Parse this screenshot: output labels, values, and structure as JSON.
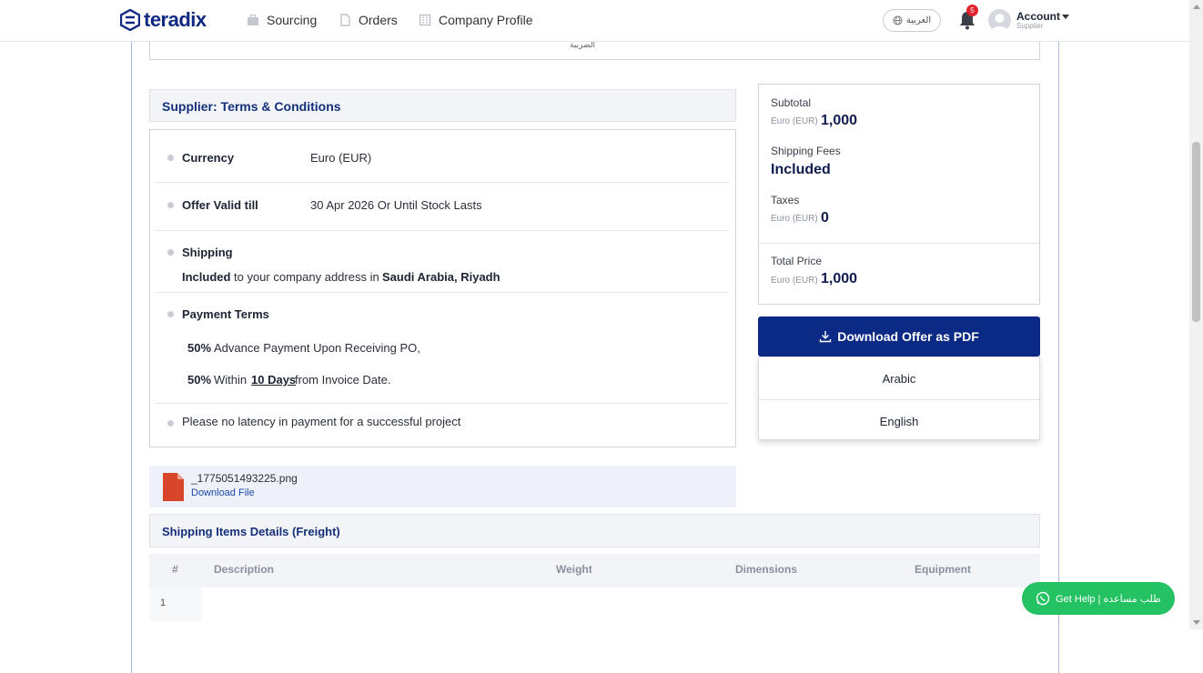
{
  "nav": {
    "logo": "teradix",
    "items": [
      {
        "label": "Sourcing",
        "icon": "briefcase-icon"
      },
      {
        "label": "Orders",
        "icon": "document-icon"
      },
      {
        "label": "Company Profile",
        "icon": "building-icon"
      }
    ],
    "language_button": "العربية",
    "notification_count": "5",
    "account_label": "Account",
    "account_role": "Supplier"
  },
  "previous_section_text": "الضريبة",
  "terms": {
    "title": "Supplier: Terms & Conditions",
    "currency_label": "Currency",
    "currency_value": "Euro (EUR)",
    "valid_label": "Offer Valid till",
    "valid_value": "30 Apr 2026 Or Until Stock Lasts",
    "shipping_label": "Shipping",
    "shipping_included": "Included",
    "shipping_text": "to your company address in",
    "shipping_location": "Saudi Arabia, Riyadh",
    "payment_label": "Payment Terms",
    "payment_1_pct": "50%",
    "payment_1_text": "Advance Payment Upon Receiving PO,",
    "payment_2_pct": "50%",
    "payment_2_within": "Within",
    "payment_2_days": "10 Days",
    "payment_2_text": "from Invoice Date.",
    "note": "Please no latency in payment for a successful project"
  },
  "summary": {
    "subtotal_label": "Subtotal",
    "subtotal_currency": "Euro (EUR)",
    "subtotal_value": "1,000",
    "shipping_label": "Shipping Fees",
    "shipping_value": "Included",
    "taxes_label": "Taxes",
    "taxes_currency": "Euro (EUR)",
    "taxes_value": "0",
    "total_label": "Total Price",
    "total_currency": "Euro (EUR)",
    "total_value": "1,000"
  },
  "download": {
    "button_label": "Download Offer as PDF",
    "options": [
      "Arabic",
      "English"
    ]
  },
  "attachment": {
    "file_name": "_1775051493225.png",
    "link_label": "Download File"
  },
  "shipping_items": {
    "title": "Shipping Items Details (Freight)",
    "columns": [
      "#",
      "Description",
      "Weight",
      "Dimensions",
      "Equipment"
    ],
    "rows": [
      {
        "num": "1"
      }
    ]
  },
  "help_button": "Get Help | طلب مساعده",
  "colors": {
    "brand": "#102a83",
    "primary_button": "#0b2a85",
    "help_button": "#25c263",
    "badge": "#e0232c",
    "file_icon": "#d9452b"
  }
}
